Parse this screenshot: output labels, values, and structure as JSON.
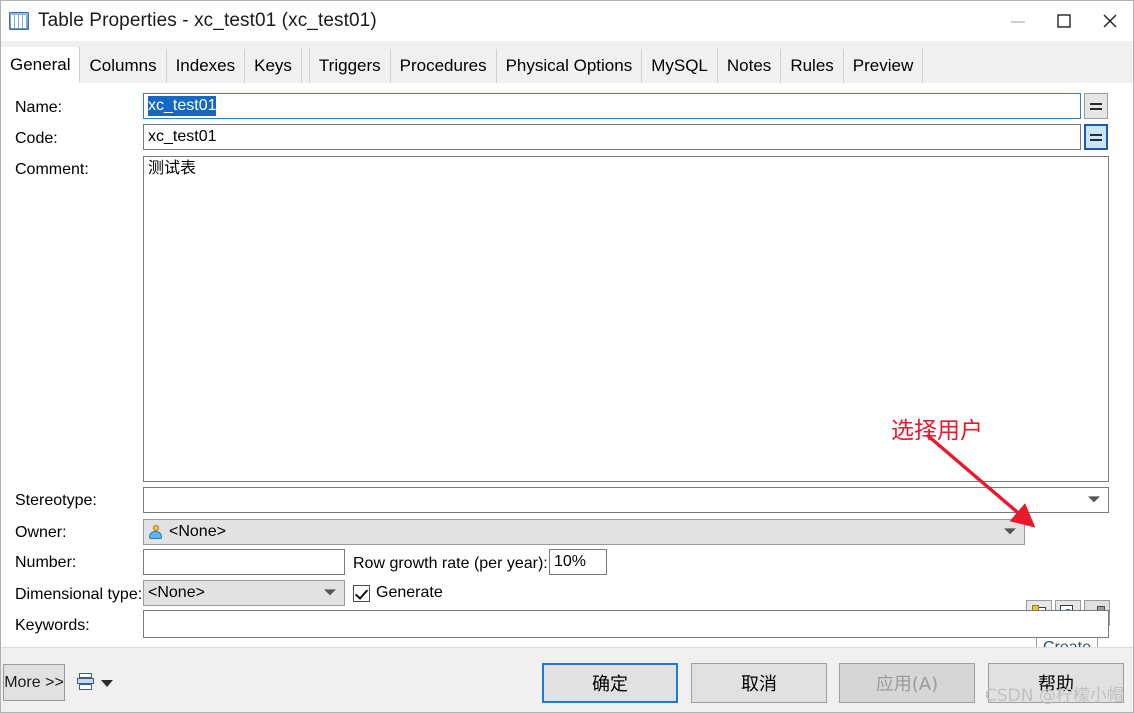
{
  "window": {
    "title": "Table Properties - xc_test01 (xc_test01)",
    "icon": "table-icon",
    "minimize_label": "—",
    "maximize_label": "□",
    "close_label": "✕"
  },
  "tabs": [
    {
      "label": "General",
      "active": true
    },
    {
      "label": "Columns",
      "active": false
    },
    {
      "label": "Indexes",
      "active": false
    },
    {
      "label": "Keys",
      "active": false
    },
    {
      "label": "Triggers",
      "active": false
    },
    {
      "label": "Procedures",
      "active": false
    },
    {
      "label": "Physical Options",
      "active": false
    },
    {
      "label": "MySQL",
      "active": false
    },
    {
      "label": "Notes",
      "active": false
    },
    {
      "label": "Rules",
      "active": false
    },
    {
      "label": "Preview",
      "active": false
    }
  ],
  "form": {
    "name": {
      "label": "Name:",
      "value": "xc_test01",
      "selected": true,
      "equals_button": "="
    },
    "code": {
      "label": "Code:",
      "value": "xc_test01",
      "equals_button": "="
    },
    "comment": {
      "label": "Comment:",
      "value": "测试表"
    },
    "stereotype": {
      "label": "Stereotype:",
      "value": ""
    },
    "owner": {
      "label": "Owner:",
      "value": "<None>",
      "icon": "person-icon"
    },
    "number": {
      "label": "Number:",
      "value": ""
    },
    "row_growth": {
      "label": "Row growth rate (per year):",
      "value": "10%"
    },
    "dimensional_type": {
      "label": "Dimensional type:",
      "value": "<None>"
    },
    "generate": {
      "label": "Generate",
      "checked": true
    },
    "keywords": {
      "label": "Keywords:",
      "value": ""
    },
    "owner_buttons": [
      {
        "name": "create-user-icon",
        "icon": "new-document-icon",
        "disabled": false
      },
      {
        "name": "browse-user-icon",
        "icon": "magnifier-page-icon",
        "disabled": false
      },
      {
        "name": "properties-icon",
        "icon": "cube-icon",
        "disabled": true
      }
    ],
    "create_button": "Create"
  },
  "annotation": {
    "text": "选择用户",
    "color": "#e8192c"
  },
  "footer": {
    "more_label": "More >>",
    "print_icon": "print-icon",
    "print_caret": "chevron-down-icon",
    "buttons": [
      {
        "label": "确定",
        "state": "default"
      },
      {
        "label": "取消",
        "state": "normal"
      },
      {
        "label": "应用(A)",
        "state": "disabled"
      },
      {
        "label": "帮助",
        "state": "normal"
      }
    ]
  },
  "watermark": {
    "text": "CSDN @柠檬小帽"
  }
}
